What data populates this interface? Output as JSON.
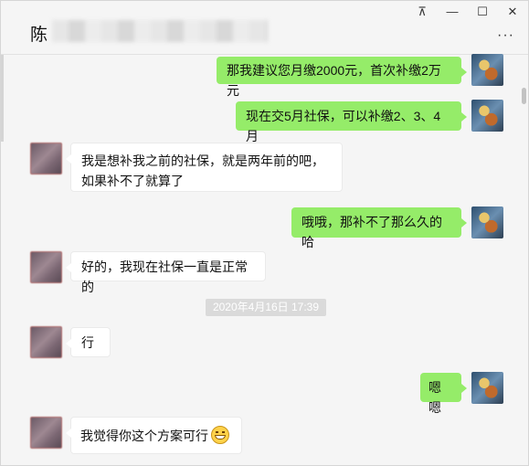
{
  "window": {
    "title_prefix": "陈",
    "controls": {
      "pin": "⊼",
      "minimize": "—",
      "maximize": "☐",
      "close": "✕"
    },
    "more": "···"
  },
  "messages": [
    {
      "side": "out",
      "text": "那我建议您月缴2000元，首次补缴2万元"
    },
    {
      "side": "out",
      "text": "现在交5月社保，可以补缴2、3、4月"
    },
    {
      "side": "in",
      "text": "我是想补我之前的社保，就是两年前的吧，如果补不了就算了"
    },
    {
      "side": "out",
      "text": "哦哦，那补不了那么久的哈"
    },
    {
      "side": "in",
      "text": "好的，我现在社保一直是正常的"
    },
    {
      "side": "in",
      "text": "行"
    },
    {
      "side": "out",
      "text": "嗯嗯"
    },
    {
      "side": "in",
      "text": "我觉得你这个方案可行",
      "emoji": "grin-icon"
    }
  ],
  "timestamp": "2020年4月16日 17:39"
}
